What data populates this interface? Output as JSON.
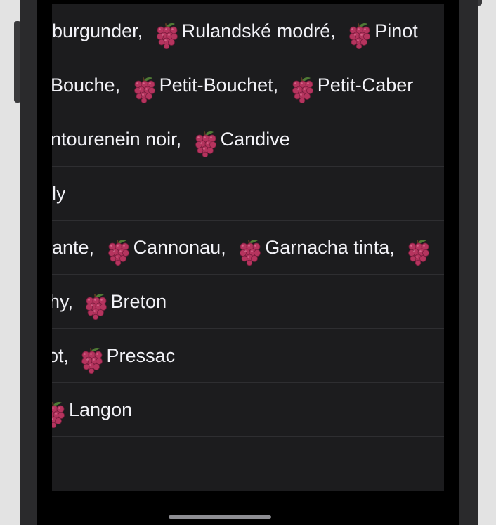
{
  "list": {
    "rows": [
      {
        "segments": [
          {
            "text": "burgunder,",
            "icon": false
          },
          {
            "text": "Rulandské modré,",
            "icon": true
          },
          {
            "text": "Pinot",
            "icon": true
          }
        ]
      },
      {
        "segments": [
          {
            "text": "Bouche,",
            "icon": false
          },
          {
            "text": "Petit-Bouchet,",
            "icon": true
          },
          {
            "text": "Petit-Caber",
            "icon": true
          }
        ]
      },
      {
        "segments": [
          {
            "text": "ntourenein noir,",
            "icon": false
          },
          {
            "text": "Candive",
            "icon": true
          }
        ]
      },
      {
        "segments": [
          {
            "text": "ily",
            "icon": false
          }
        ]
      },
      {
        "segments": [
          {
            "text": "ante,",
            "icon": false
          },
          {
            "text": "Cannonau,",
            "icon": true
          },
          {
            "text": "Garnacha tinta,",
            "icon": true
          },
          {
            "text": "",
            "icon": true
          }
        ]
      },
      {
        "segments": [
          {
            "text": "hy,",
            "icon": false
          },
          {
            "text": "Breton",
            "icon": true
          }
        ]
      },
      {
        "segments": [
          {
            "text": "ot,",
            "icon": false
          },
          {
            "text": "Pressac",
            "icon": true
          }
        ]
      },
      {
        "segments": [
          {
            "text": "",
            "icon": true
          },
          {
            "text": "Langon",
            "icon": false
          }
        ]
      }
    ]
  },
  "colors": {
    "background": "#1c1c1e",
    "text": "#f2f2f7",
    "separator": "#2e2e31",
    "grape": "#b5345e"
  },
  "icons": {
    "grape": "grapes-icon"
  }
}
